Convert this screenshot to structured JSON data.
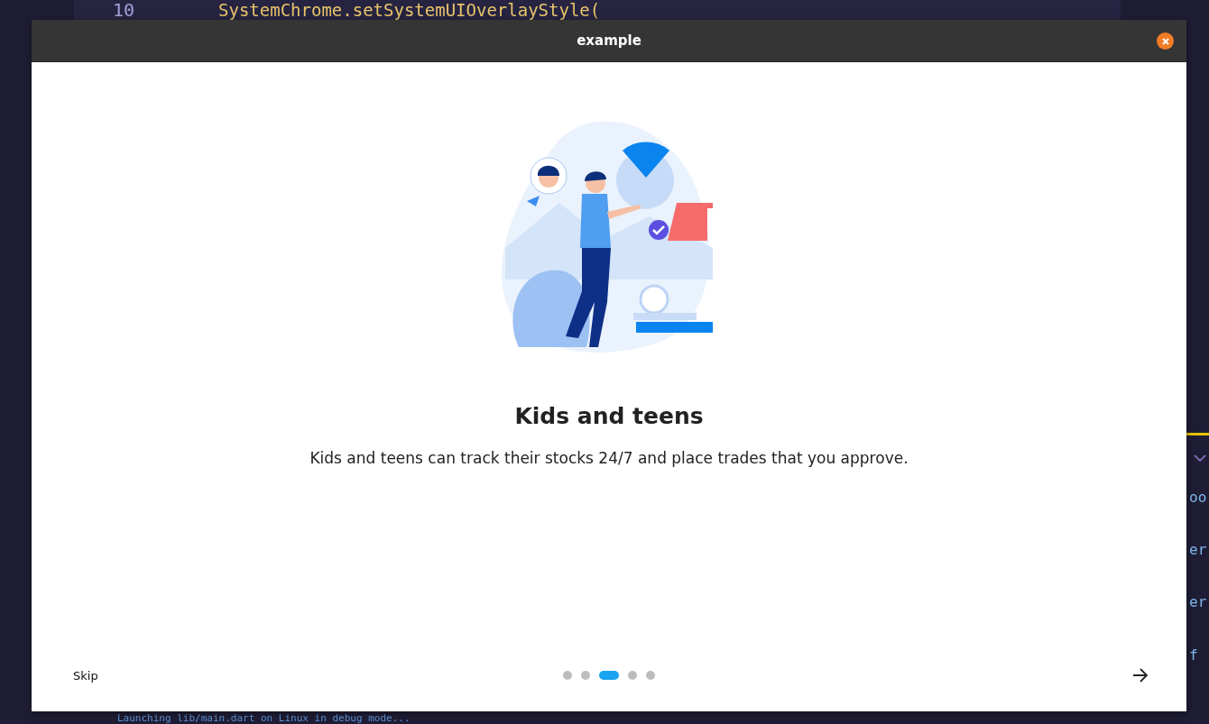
{
  "background_editor": {
    "line_number": "10",
    "code_line": "SystemChrome.setSystemUIOverlayStyle(",
    "side_fragments": [
      "oo",
      "er",
      "er",
      "f"
    ],
    "terminal_line": "Launching lib/main.dart on Linux in debug mode..."
  },
  "window": {
    "title": "example"
  },
  "page": {
    "heading": "Kids and teens",
    "body": "Kids and teens can track their stocks 24/7 and place trades that you approve."
  },
  "footer": {
    "skip": "Skip",
    "dots": [
      {
        "selected": false
      },
      {
        "selected": false
      },
      {
        "selected": true
      },
      {
        "selected": false
      },
      {
        "selected": false
      }
    ]
  }
}
